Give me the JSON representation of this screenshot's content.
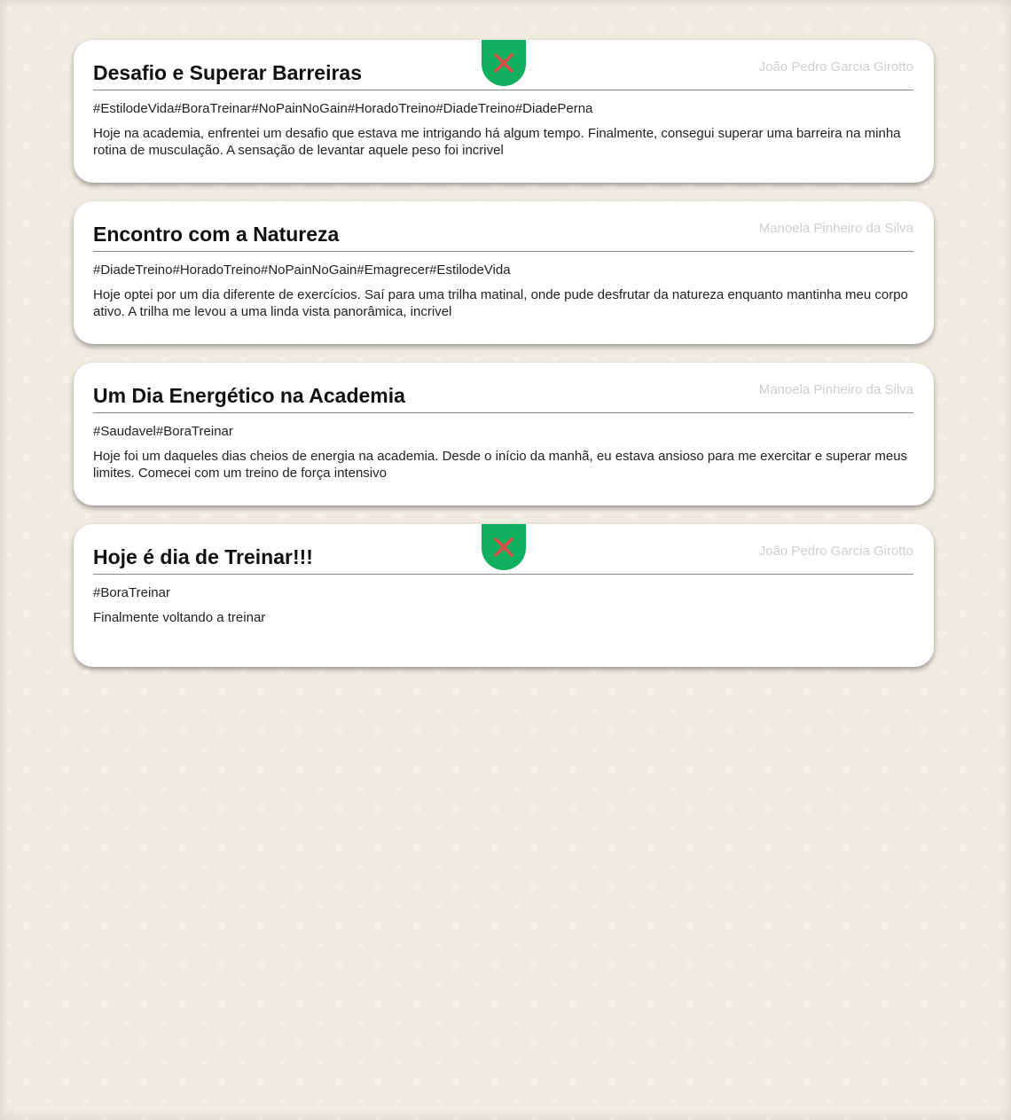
{
  "posts": [
    {
      "title": "Desafio e Superar Barreiras",
      "author": "João Pedro Garcia Girotto",
      "tags": "#EstilodeVida#BoraTreinar#NoPainNoGain#HoradoTreino#DiadeTreino#DiadePerna",
      "text": "Hoje na academia, enfrentei um desafio que estava me intrigando há algum tempo. Finalmente, consegui superar uma barreira na minha rotina de musculação. A sensação de levantar aquele peso foi incrivel",
      "deletable": true
    },
    {
      "title": "Encontro com a Natureza",
      "author": "Manoela Pinheiro da Silva",
      "tags": "#DiadeTreino#HoradoTreino#NoPainNoGain#Emagrecer#EstilodeVida",
      "text": "Hoje optei por um dia diferente de exercícios. Saí para uma trilha matinal, onde pude desfrutar da natureza enquanto mantinha meu corpo ativo. A trilha me levou a uma linda vista panorâmica, incrivel",
      "deletable": false
    },
    {
      "title": "Um Dia Energético na Academia",
      "author": "Manoela Pinheiro da Silva",
      "tags": "#Saudavel#BoraTreinar",
      "text": "Hoje foi um daqueles dias cheios de energia na academia. Desde o início da manhã, eu estava ansioso para me exercitar e superar meus limites. Comecei com um treino de força intensivo",
      "deletable": false
    },
    {
      "title": "Hoje é dia de Treinar!!!",
      "author": "João Pedro Garcia Girotto",
      "tags": "#BoraTreinar",
      "text": "Finalmente voltando a treinar",
      "deletable": true
    }
  ],
  "colors": {
    "background": "#efebe1",
    "delete_button": "#10b060",
    "delete_icon": "#e04848",
    "author_text": "#cfcfcf"
  },
  "icons": {
    "delete": "close-icon"
  }
}
